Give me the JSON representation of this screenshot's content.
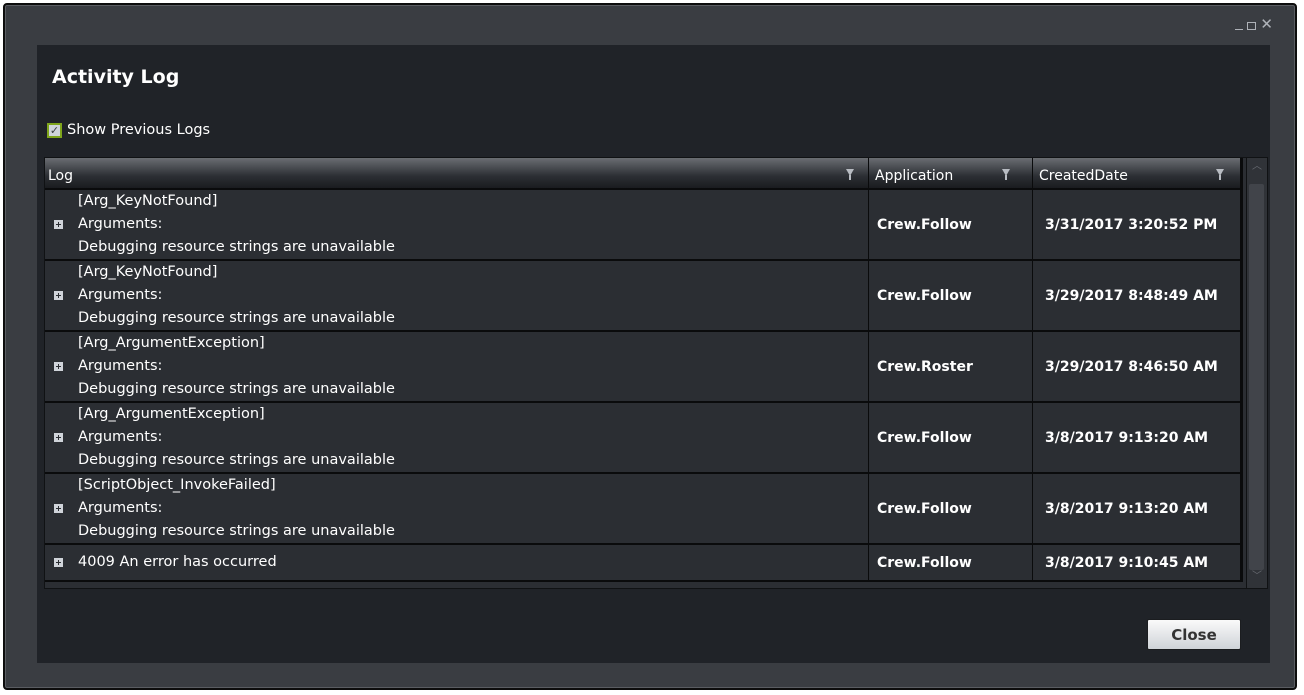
{
  "window": {
    "controls": {
      "minimize": "_",
      "maximize": "□",
      "close": "✕"
    }
  },
  "dialog": {
    "title": "Activity Log",
    "show_previous_logs": {
      "label": "Show Previous Logs",
      "checked": true
    }
  },
  "grid": {
    "columns": [
      {
        "label": "Log"
      },
      {
        "label": "Application"
      },
      {
        "label": "CreatedDate"
      }
    ],
    "rows": [
      {
        "log": [
          "[Arg_KeyNotFound]",
          "Arguments:",
          "Debugging resource strings are unavailable"
        ],
        "application": "Crew.Follow",
        "created": "3/31/2017 3:20:52 PM"
      },
      {
        "log": [
          "[Arg_KeyNotFound]",
          "Arguments:",
          "Debugging resource strings are unavailable"
        ],
        "application": "Crew.Follow",
        "created": "3/29/2017 8:48:49 AM"
      },
      {
        "log": [
          "[Arg_ArgumentException]",
          "Arguments:",
          "Debugging resource strings are unavailable"
        ],
        "application": "Crew.Roster",
        "created": "3/29/2017 8:46:50 AM"
      },
      {
        "log": [
          "[Arg_ArgumentException]",
          "Arguments:",
          "Debugging resource strings are unavailable"
        ],
        "application": "Crew.Follow",
        "created": "3/8/2017 9:13:20 AM"
      },
      {
        "log": [
          "[ScriptObject_InvokeFailed]",
          "Arguments:",
          "Debugging resource strings are unavailable"
        ],
        "application": "Crew.Follow",
        "created": "3/8/2017 9:13:20 AM"
      },
      {
        "log": [
          "4009 An error has occurred"
        ],
        "application": "Crew.Follow",
        "created": "3/8/2017 9:10:45 AM"
      }
    ]
  },
  "footer": {
    "close_label": "Close"
  },
  "colors": {
    "accent": "#7fa51c",
    "panel": "#202328",
    "row": "#2b2e33"
  },
  "icons": [
    "minimize-icon",
    "maximize-icon",
    "close-icon",
    "filter-icon",
    "expand-icon",
    "scroll-up-icon",
    "scroll-down-icon"
  ]
}
